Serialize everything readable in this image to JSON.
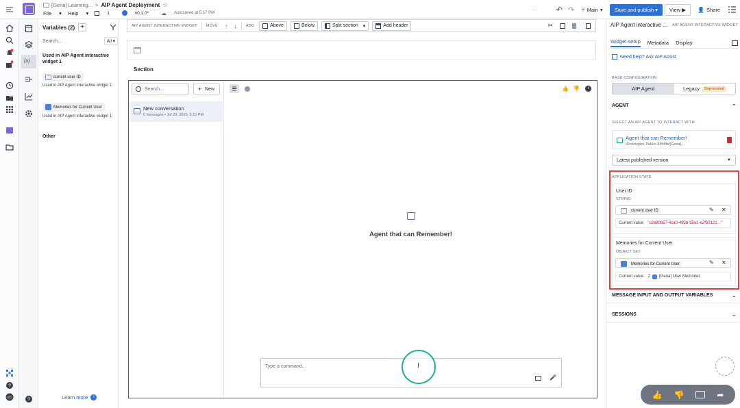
{
  "header": {
    "breadcrumb_parent": "[Gena] Learning...",
    "breadcrumb_sep": ">",
    "title": "AIP Agent Deployment",
    "menu_file": "File",
    "menu_help": "Help",
    "count": "1",
    "version": "v0.1.0*",
    "autosave": "Autosaved at 5:17 PM",
    "branch": "Main",
    "save_publish": "Save and publish",
    "view": "View",
    "share": "Share"
  },
  "variables": {
    "title": "Variables (2)",
    "search_placeholder": "Search...",
    "filter": "All",
    "group_used": "Used in AIP Agent interactive widget 1",
    "items": [
      {
        "name": "current user ID",
        "used_in": "Used in  AIP Agent interactive widget 1"
      },
      {
        "name": "Memories for Current User",
        "used_in": "Used in  AIP Agent interactive widget 1"
      }
    ],
    "group_other": "Other",
    "learn_more": "Learn more"
  },
  "toolbar": {
    "widget_label": "AIP AGENT INTERACTIVE WIDGET",
    "move_label": "MOVE",
    "add_label": "ADD",
    "above": "Above",
    "below": "Below",
    "split_section": "Split section",
    "add_header": "Add header"
  },
  "canvas": {
    "section_label": "Section",
    "search_placeholder": "Search...",
    "new_button": "New",
    "conversation_title": "New conversation",
    "conversation_meta": "0 messages • Jul 29, 2025, 5:15 PM",
    "agent_name": "Agent that can Remember!",
    "command_placeholder": "Type a command..."
  },
  "right_panel": {
    "title": "AIP Agent interactive ...",
    "subtitle": "AIP AGENT INTERACTIVE WIDGET",
    "tabs": [
      "Widget setup",
      "Metadata",
      "Display"
    ],
    "help_link": "Need help? Ask AIP Assist",
    "base_config_label": "BASE CONFIGURATION",
    "seg_aip": "AIP Agent",
    "seg_legacy": "Legacy",
    "deprecated": "Deprecated",
    "agent_section": "AGENT",
    "select_label": "SELECT AN AIP AGENT TO INTERACT WITH",
    "agent_name": "Agent that can Remember!",
    "agent_path": "/Ontologize Public-33fd9b/[Gena]...",
    "version_select": "Latest published version",
    "app_state_label": "APPLICATION STATE",
    "user_id_title": "User ID",
    "user_id_type": "STRING",
    "user_id_var": "current user ID",
    "current_value_label": "Current value:",
    "user_id_value": "\"c8a89b57-4ca0-483b-95a2-e2f50121...\"",
    "memories_title": "Memories for Current User",
    "memories_type": "OBJECT SET",
    "memories_var": "Memories for Current User",
    "memories_count": "2",
    "memories_value": "[Gena] User Memories",
    "msg_vars_section": "MESSAGE INPUT AND OUTPUT VARIABLES",
    "sessions_section": "SESSIONS"
  },
  "colors": {
    "primary": "#2d72d2",
    "highlight": "#e5423f",
    "widget_border": "#2d5ea8",
    "cursor_ring": "#19b18f",
    "app_logo": "#8066d6"
  }
}
